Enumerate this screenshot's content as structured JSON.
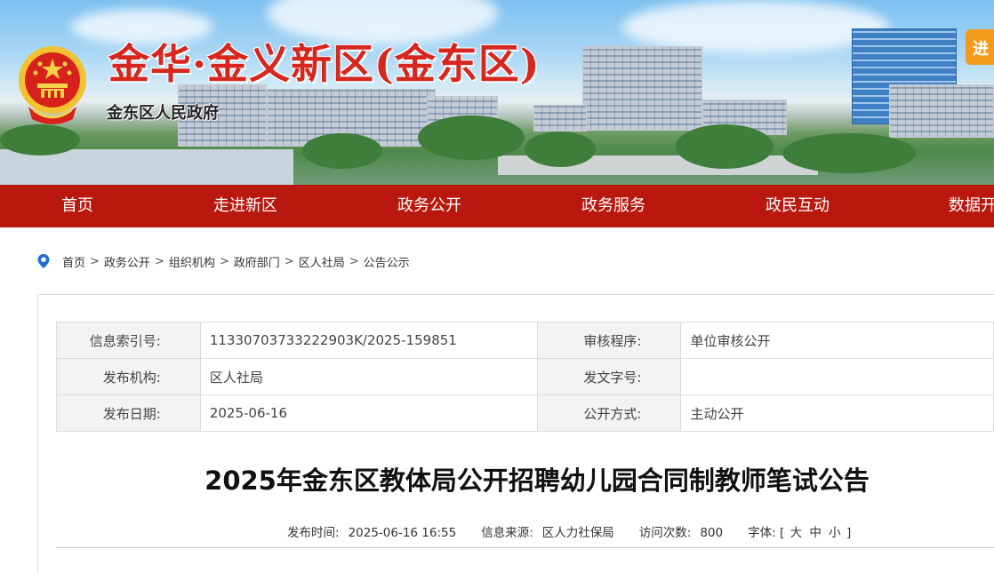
{
  "header": {
    "site_title": "金华·金义新区(金东区)",
    "site_subtitle": "金东区人民政府",
    "corner_button": "进"
  },
  "nav": {
    "items": [
      {
        "label": "首页"
      },
      {
        "label": "走进新区"
      },
      {
        "label": "政务公开"
      },
      {
        "label": "政务服务"
      },
      {
        "label": "政民互动"
      },
      {
        "label": "数据开"
      }
    ]
  },
  "breadcrumb": {
    "separator": ">",
    "items": [
      "首页",
      "政务公开",
      "组织机构",
      "政府部门",
      "区人社局",
      "公告公示"
    ]
  },
  "meta_table": {
    "rows": [
      {
        "label1": "信息索引号:",
        "value1": "11330703733222903K/2025-159851",
        "label2": "审核程序:",
        "value2": "单位审核公开"
      },
      {
        "label1": "发布机构:",
        "value1": "区人社局",
        "label2": "发文字号:",
        "value2": ""
      },
      {
        "label1": "发布日期:",
        "value1": "2025-06-16",
        "label2": "公开方式:",
        "value2": "主动公开"
      }
    ]
  },
  "article": {
    "title": "2025年金东区教体局公开招聘幼儿园合同制教师笔试公告",
    "publish_time_label": "发布时间:",
    "publish_time": "2025-06-16 16:55",
    "source_label": "信息来源:",
    "source": "区人力社保局",
    "visits_label": "访问次数:",
    "visits": "800",
    "font_size_label": "字体:",
    "font_open": "[",
    "font_large": "大",
    "font_medium": "中",
    "font_small": "小",
    "font_close": "]"
  },
  "colors": {
    "nav_bg": "#b9180e",
    "title_red": "#d7261e",
    "corner_button": "#f39a1d"
  }
}
